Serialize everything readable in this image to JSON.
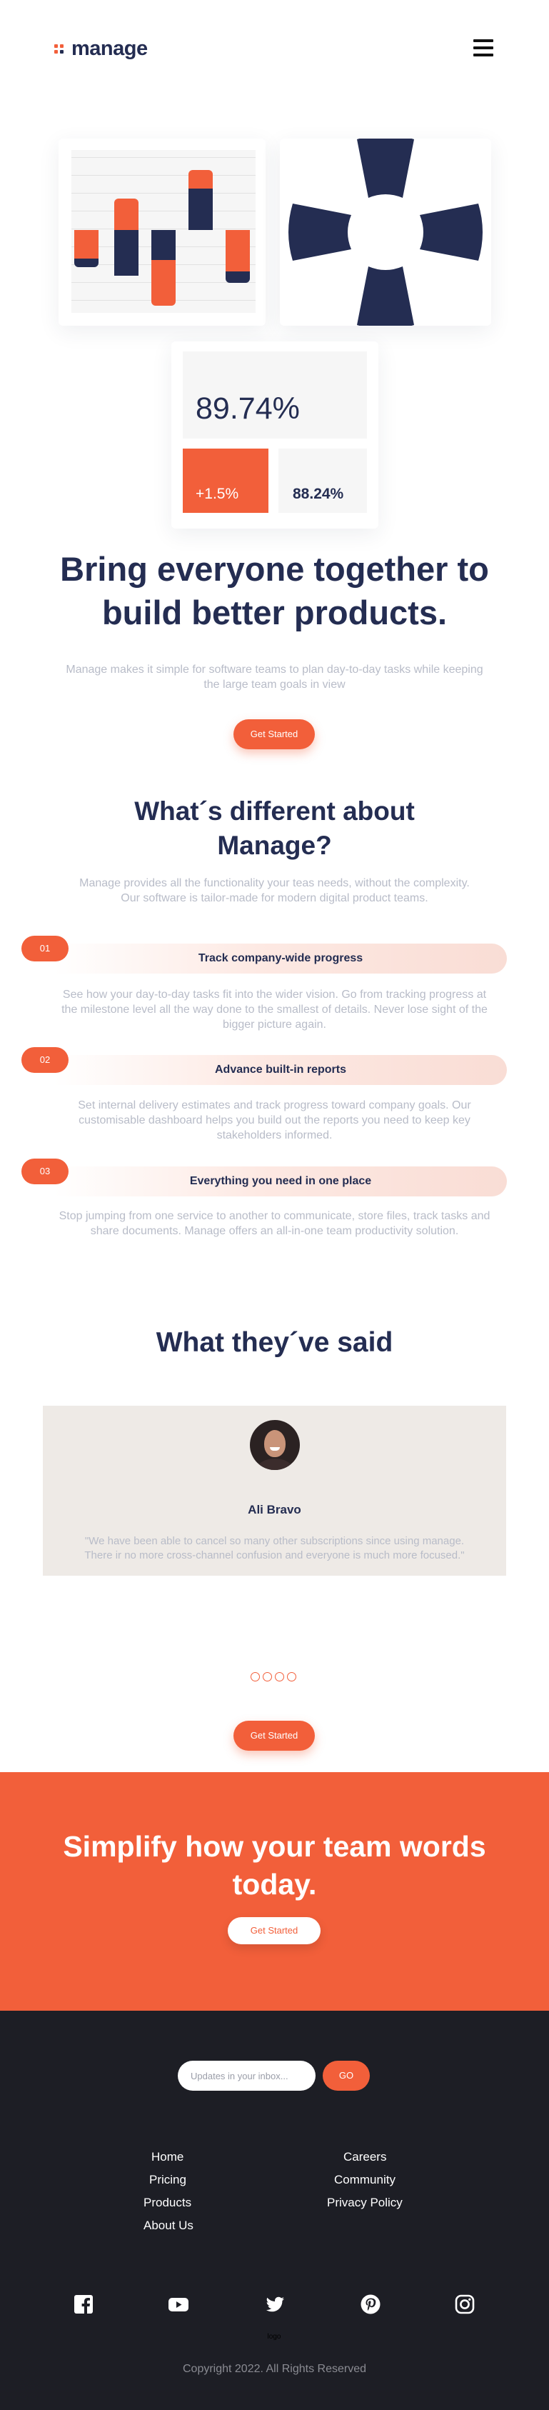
{
  "brand": {
    "name": "manage",
    "accent": "#f25f3a",
    "navy": "#242d52"
  },
  "header": {
    "menu_icon": "hamburger-icon"
  },
  "hero_stats": {
    "main_value": "89.74%",
    "change_value": "+1.5%",
    "secondary_value": "88.24%"
  },
  "hero": {
    "title": "Bring everyone together to build better products.",
    "subtitle": "Manage makes it simple for software teams to plan day-to-day tasks while keeping the large team goals in view",
    "button": "Get Started"
  },
  "different": {
    "title": "What´s different about Manage?",
    "subtitle": "Manage provides all the functionality your teas needs, without the complexity. Our software is tailor-made for modern digital product teams.",
    "features": [
      {
        "number": "01",
        "title": "Track company-wide progress",
        "description": "See how your day-to-day tasks fit into the wider vision. Go from tracking progress at the milestone level all the way done to the smallest of details. Never lose sight of the bigger picture again."
      },
      {
        "number": "02",
        "title": "Advance built-in reports",
        "description": "Set internal delivery estimates and track progress toward company goals. Our customisable dashboard helps you build out the reports you need to keep key stakeholders informed."
      },
      {
        "number": "03",
        "title": "Everything you need in one place",
        "description": "Stop jumping from one service to another to communicate, store files, track tasks and share documents. Manage offers an all-in-one team productivity solution."
      }
    ]
  },
  "testimonials": {
    "title": "What they´ve said",
    "name": "Ali Bravo",
    "quote": "\"We have been able to cancel so many other subscriptions since using manage. There ir no more cross-channel confusion and everyone is much more focused.\"",
    "button": "Get Started"
  },
  "cta": {
    "title": "Simplify how your team words today.",
    "button": "Get Started"
  },
  "footer": {
    "newsletter_placeholder": "Updates in your inbox...",
    "newsletter_button": "GO",
    "nav_left": [
      "Home",
      "Pricing",
      "Products",
      "About Us"
    ],
    "nav_right": [
      "Careers",
      "Community",
      "Privacy Policy"
    ],
    "social_icons": [
      "facebook-icon",
      "youtube-icon",
      "twitter-icon",
      "pinterest-icon",
      "instagram-icon"
    ],
    "logo_text": "logo",
    "copyright": "Copyright 2022. All Rights Reserved"
  }
}
